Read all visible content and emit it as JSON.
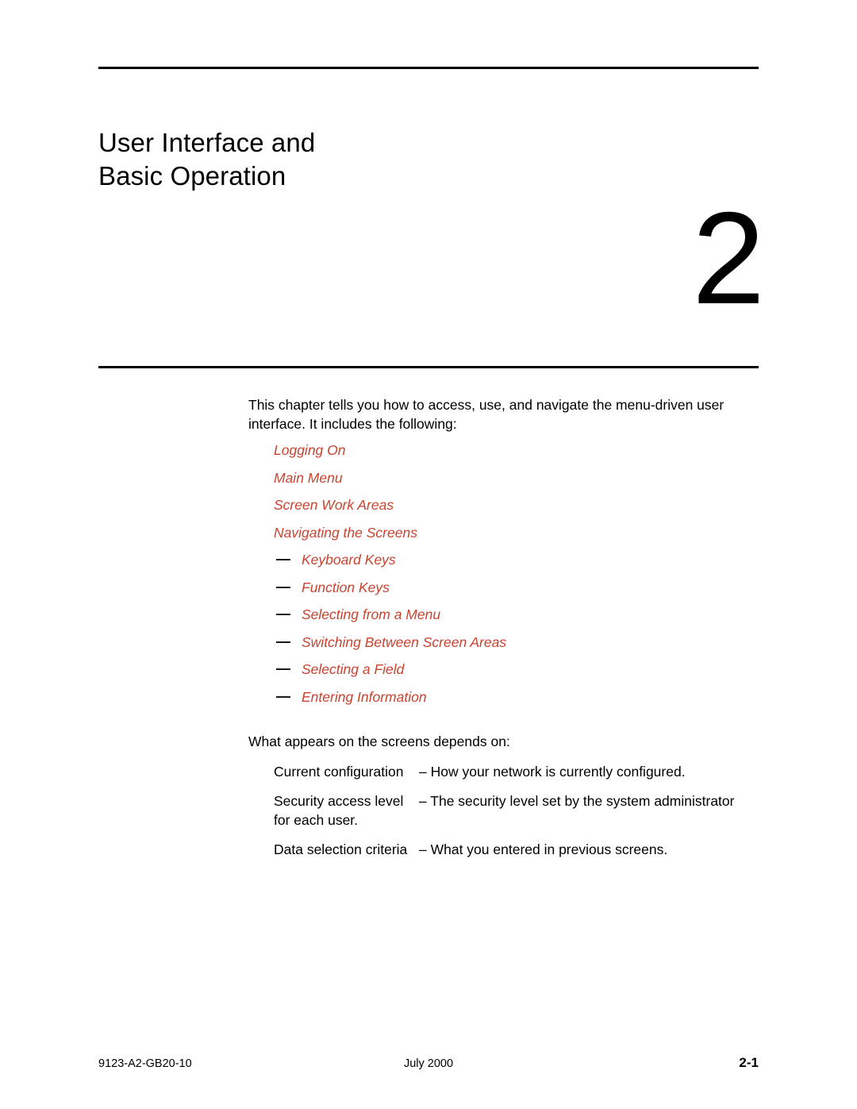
{
  "document": {
    "chapter_title": "User Interface and\nBasic Operation",
    "chapter_number": "2"
  },
  "intro": {
    "paragraph": "This chapter tells you how to access, use, and navigate the menu-driven user interface. It includes the following:"
  },
  "xref_list": [
    {
      "label": "Logging On",
      "level": 1,
      "dash": false
    },
    {
      "label": "Main Menu",
      "level": 1,
      "dash": false
    },
    {
      "label": "Screen Work Areas",
      "level": 1,
      "dash": false
    },
    {
      "label": "Navigating the Screens",
      "level": 1,
      "dash": false
    },
    {
      "label": "Keyboard Keys",
      "level": 2,
      "dash": true
    },
    {
      "label": "Function Keys",
      "level": 2,
      "dash": true
    },
    {
      "label": "Selecting from a Menu",
      "level": 2,
      "dash": true
    },
    {
      "label": "Switching Between Screen Areas",
      "level": 2,
      "dash": true
    },
    {
      "label": "Selecting a Field",
      "level": 2,
      "dash": true
    },
    {
      "label": "Entering Information",
      "level": 2,
      "dash": true
    }
  ],
  "depends": {
    "intro": "What appears on the screens depends on:",
    "rows": [
      {
        "term": "Current configuration",
        "description": "– How your network is currently configured.",
        "continuation": ""
      },
      {
        "term": "Security access level",
        "description": "– The security level set by the system administrator",
        "continuation": "for each user."
      },
      {
        "term": "Data selection criteria",
        "description": "– What you entered in previous screens.",
        "continuation": ""
      }
    ]
  },
  "footer": {
    "document_number": "9123-A2-GB20-10",
    "date": "July 2000",
    "page_number": "2-1"
  },
  "colors": {
    "xref_red": "#C9432F",
    "text_black": "#000000",
    "rule_black": "#000000"
  }
}
